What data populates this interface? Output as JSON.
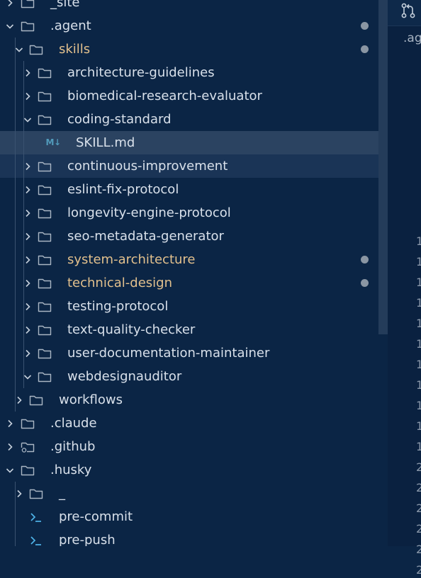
{
  "explorer": {
    "rows": [
      {
        "label": "_site",
        "depth": 0,
        "kind": "folder",
        "open": false
      },
      {
        "label": ".agent",
        "depth": 0,
        "kind": "folder",
        "open": true,
        "dot": true
      },
      {
        "label": "skills",
        "depth": 1,
        "kind": "folder",
        "open": true,
        "modified": true,
        "dot": true
      },
      {
        "label": "architecture-guidelines",
        "depth": 2,
        "kind": "folder",
        "open": false
      },
      {
        "label": "biomedical-research-evaluator",
        "depth": 2,
        "kind": "folder",
        "open": false
      },
      {
        "label": "coding-standard",
        "depth": 2,
        "kind": "folder",
        "open": true
      },
      {
        "label": "SKILL.md",
        "depth": 3,
        "kind": "markdown",
        "state": "selected"
      },
      {
        "label": "continuous-improvement",
        "depth": 2,
        "kind": "folder",
        "open": false,
        "state": "hover"
      },
      {
        "label": "eslint-fix-protocol",
        "depth": 2,
        "kind": "folder",
        "open": false
      },
      {
        "label": "longevity-engine-protocol",
        "depth": 2,
        "kind": "folder",
        "open": false
      },
      {
        "label": "seo-metadata-generator",
        "depth": 2,
        "kind": "folder",
        "open": false
      },
      {
        "label": "system-architecture",
        "depth": 2,
        "kind": "folder",
        "open": false,
        "modified": true,
        "dot": true
      },
      {
        "label": "technical-design",
        "depth": 2,
        "kind": "folder",
        "open": false,
        "modified": true,
        "dot": true
      },
      {
        "label": "testing-protocol",
        "depth": 2,
        "kind": "folder",
        "open": false
      },
      {
        "label": "text-quality-checker",
        "depth": 2,
        "kind": "folder",
        "open": false
      },
      {
        "label": "user-documentation-maintainer",
        "depth": 2,
        "kind": "folder",
        "open": false
      },
      {
        "label": "webdesignauditor",
        "depth": 2,
        "kind": "folder",
        "open": true
      },
      {
        "label": "workflows",
        "depth": 1,
        "kind": "folder",
        "open": false
      },
      {
        "label": ".claude",
        "depth": 0,
        "kind": "folder",
        "open": false
      },
      {
        "label": ".github",
        "depth": 0,
        "kind": "folder-github",
        "open": false
      },
      {
        "label": ".husky",
        "depth": 0,
        "kind": "folder",
        "open": true
      },
      {
        "label": "_",
        "depth": 1,
        "kind": "folder",
        "open": false
      },
      {
        "label": "pre-commit",
        "depth": 1,
        "kind": "shell"
      },
      {
        "label": "pre-push",
        "depth": 1,
        "kind": "shell"
      }
    ]
  },
  "editor": {
    "tab_label": ".ag",
    "line_numbers": [
      "1",
      "1",
      "1",
      "1",
      "1",
      "1",
      "1",
      "1",
      "1",
      "1",
      "1",
      "2",
      "2",
      "2",
      "2",
      "2",
      "2"
    ]
  },
  "icons": {
    "branch": "source-control-icon",
    "markdown_badge": "M↓"
  },
  "colors": {
    "background": "#0b2545",
    "modified": "#e2c08d",
    "markdown": "#519aba",
    "selected": "#2b4361"
  }
}
